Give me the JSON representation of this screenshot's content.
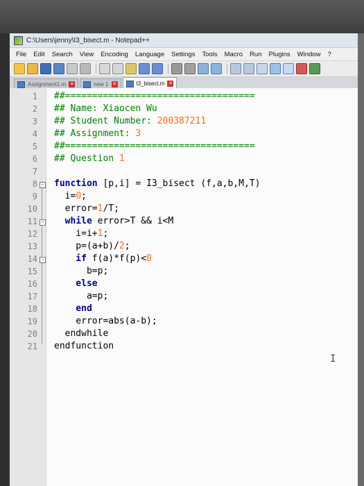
{
  "window": {
    "title": "C:\\Users\\jenny\\I3_bisect.m - Notepad++"
  },
  "menu": [
    "File",
    "Edit",
    "Search",
    "View",
    "Encoding",
    "Language",
    "Settings",
    "Tools",
    "Macro",
    "Run",
    "Plugins",
    "Window",
    "?"
  ],
  "tabs": [
    {
      "label": "Assignment1.m",
      "active": false
    },
    {
      "label": "new 1",
      "active": false
    },
    {
      "label": "I3_bisect.m",
      "active": true
    }
  ],
  "editor": {
    "line_numbers": [
      "1",
      "2",
      "3",
      "4",
      "5",
      "6",
      "7",
      "8",
      "9",
      "10",
      "11",
      "12",
      "13",
      "14",
      "15",
      "16",
      "17",
      "18",
      "19",
      "20",
      "21"
    ],
    "lines": {
      "l1": "##===================================",
      "l2a": "## Name: Xiaocen Wu",
      "l3a": "## Student Number: ",
      "l3b": "200387211",
      "l4a": "## Assignment: ",
      "l4b": "3",
      "l5": "##===================================",
      "l6a": "## Question ",
      "l6b": "1",
      "l7": "",
      "l8a": "function",
      "l8b": " [p,i] = I3_bisect (f,a,b,M,T)",
      "l9a": "  i=",
      "l9b": "0",
      "l9c": ";",
      "l10a": "  error=",
      "l10b": "1",
      "l10c": "/T;",
      "l11a": "  while",
      "l11b": " error>T && i<M",
      "l12a": "    i=i+",
      "l12b": "1",
      "l12c": ";",
      "l13a": "    p=(a+b)/",
      "l13b": "2",
      "l13c": ";",
      "l14a": "    if",
      "l14b": " f(a)*f(p)<",
      "l14c": "0",
      "l15": "      b=p;",
      "l16": "    else",
      "l17": "      a=p;",
      "l18": "    end",
      "l19": "    error=abs(a-b);",
      "l20": "  endwhile",
      "l21": "endfunction"
    }
  }
}
